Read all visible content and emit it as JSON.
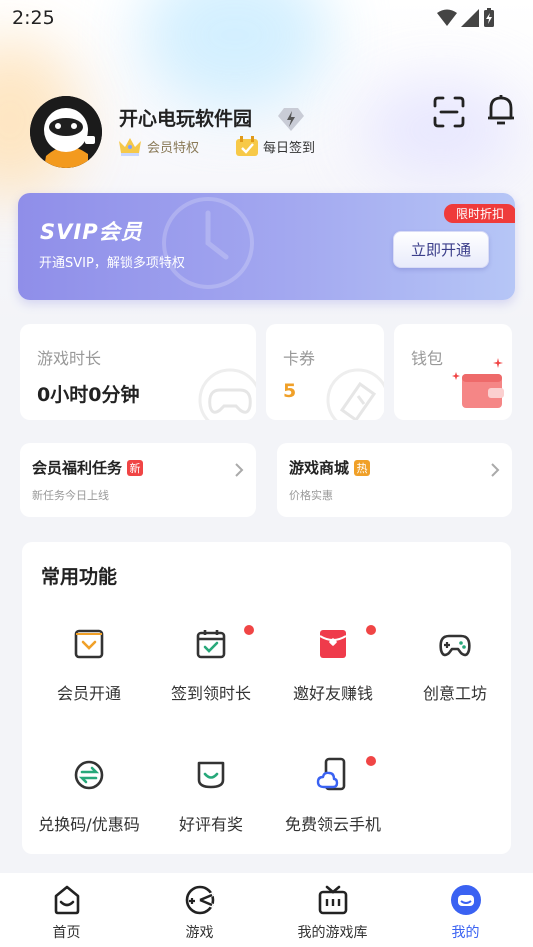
{
  "status_bar": {
    "time": "2:25"
  },
  "profile": {
    "username": "开心电玩软件园",
    "member_tag": "会员特权",
    "checkin_tag": "每日签到"
  },
  "svip": {
    "title": "SVIP会员",
    "subtitle": "开通SVIP，解锁多项特权",
    "button": "立即开通",
    "flag": "限时折扣"
  },
  "stats": {
    "play_time": {
      "label": "游戏时长",
      "value": "0小时0分钟"
    },
    "coupons": {
      "label": "卡券",
      "value": "5"
    },
    "wallet": {
      "label": "钱包"
    }
  },
  "tasks": {
    "member_tasks": {
      "title": "会员福利任务",
      "badge": "新",
      "subtitle": "新任务今日上线"
    },
    "game_store": {
      "title": "游戏商城",
      "badge": "热",
      "subtitle": "价格实惠"
    }
  },
  "common_functions": {
    "title": "常用功能",
    "items": [
      {
        "label": "会员开通",
        "icon": "member-card-icon"
      },
      {
        "label": "签到领时长",
        "icon": "calendar-check-icon"
      },
      {
        "label": "邀好友赚钱",
        "icon": "red-envelope-icon"
      },
      {
        "label": "创意工坊",
        "icon": "gamepad-icon"
      },
      {
        "label": "兑换码/优惠码",
        "icon": "exchange-icon"
      },
      {
        "label": "好评有奖",
        "icon": "smile-icon"
      },
      {
        "label": "免费领云手机",
        "icon": "cloud-phone-icon"
      }
    ]
  },
  "bottom_nav": {
    "items": [
      {
        "label": "首页",
        "icon": "home-icon"
      },
      {
        "label": "游戏",
        "icon": "game-icon"
      },
      {
        "label": "我的游戏库",
        "icon": "library-icon"
      },
      {
        "label": "我的",
        "icon": "profile-icon"
      }
    ],
    "active": "我的"
  },
  "colors": {
    "accent_blue": "#3a62f2",
    "badge_red": "#f04545",
    "badge_orange": "#f0a028",
    "svip_purple": "#8f8ee9",
    "icon_green": "#27a87a"
  }
}
